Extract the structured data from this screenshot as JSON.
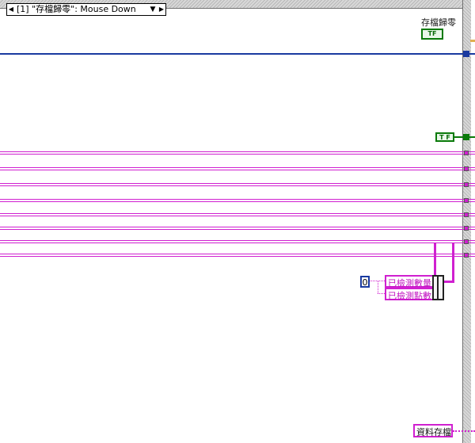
{
  "event_case": {
    "selector_text": "[1] \"存檔歸零\": Mouse Down",
    "prev_arrow": "◀",
    "next_arrow": "▶",
    "dropdown_arrow": "▼"
  },
  "controls": {
    "save_reset_label": "存檔歸零",
    "save_reset_terminal": "TF",
    "bool_const_text": "T F",
    "zero_constant": "0",
    "detected_count_label": "已檢測數量",
    "detected_points_label": "已檢測點數",
    "data_save_label": "資料存檔"
  },
  "colors": {
    "boolean_wire": "#0a7a0a",
    "cluster_wire": "#d020d0",
    "refnum_wire": "#1a3aa0"
  }
}
